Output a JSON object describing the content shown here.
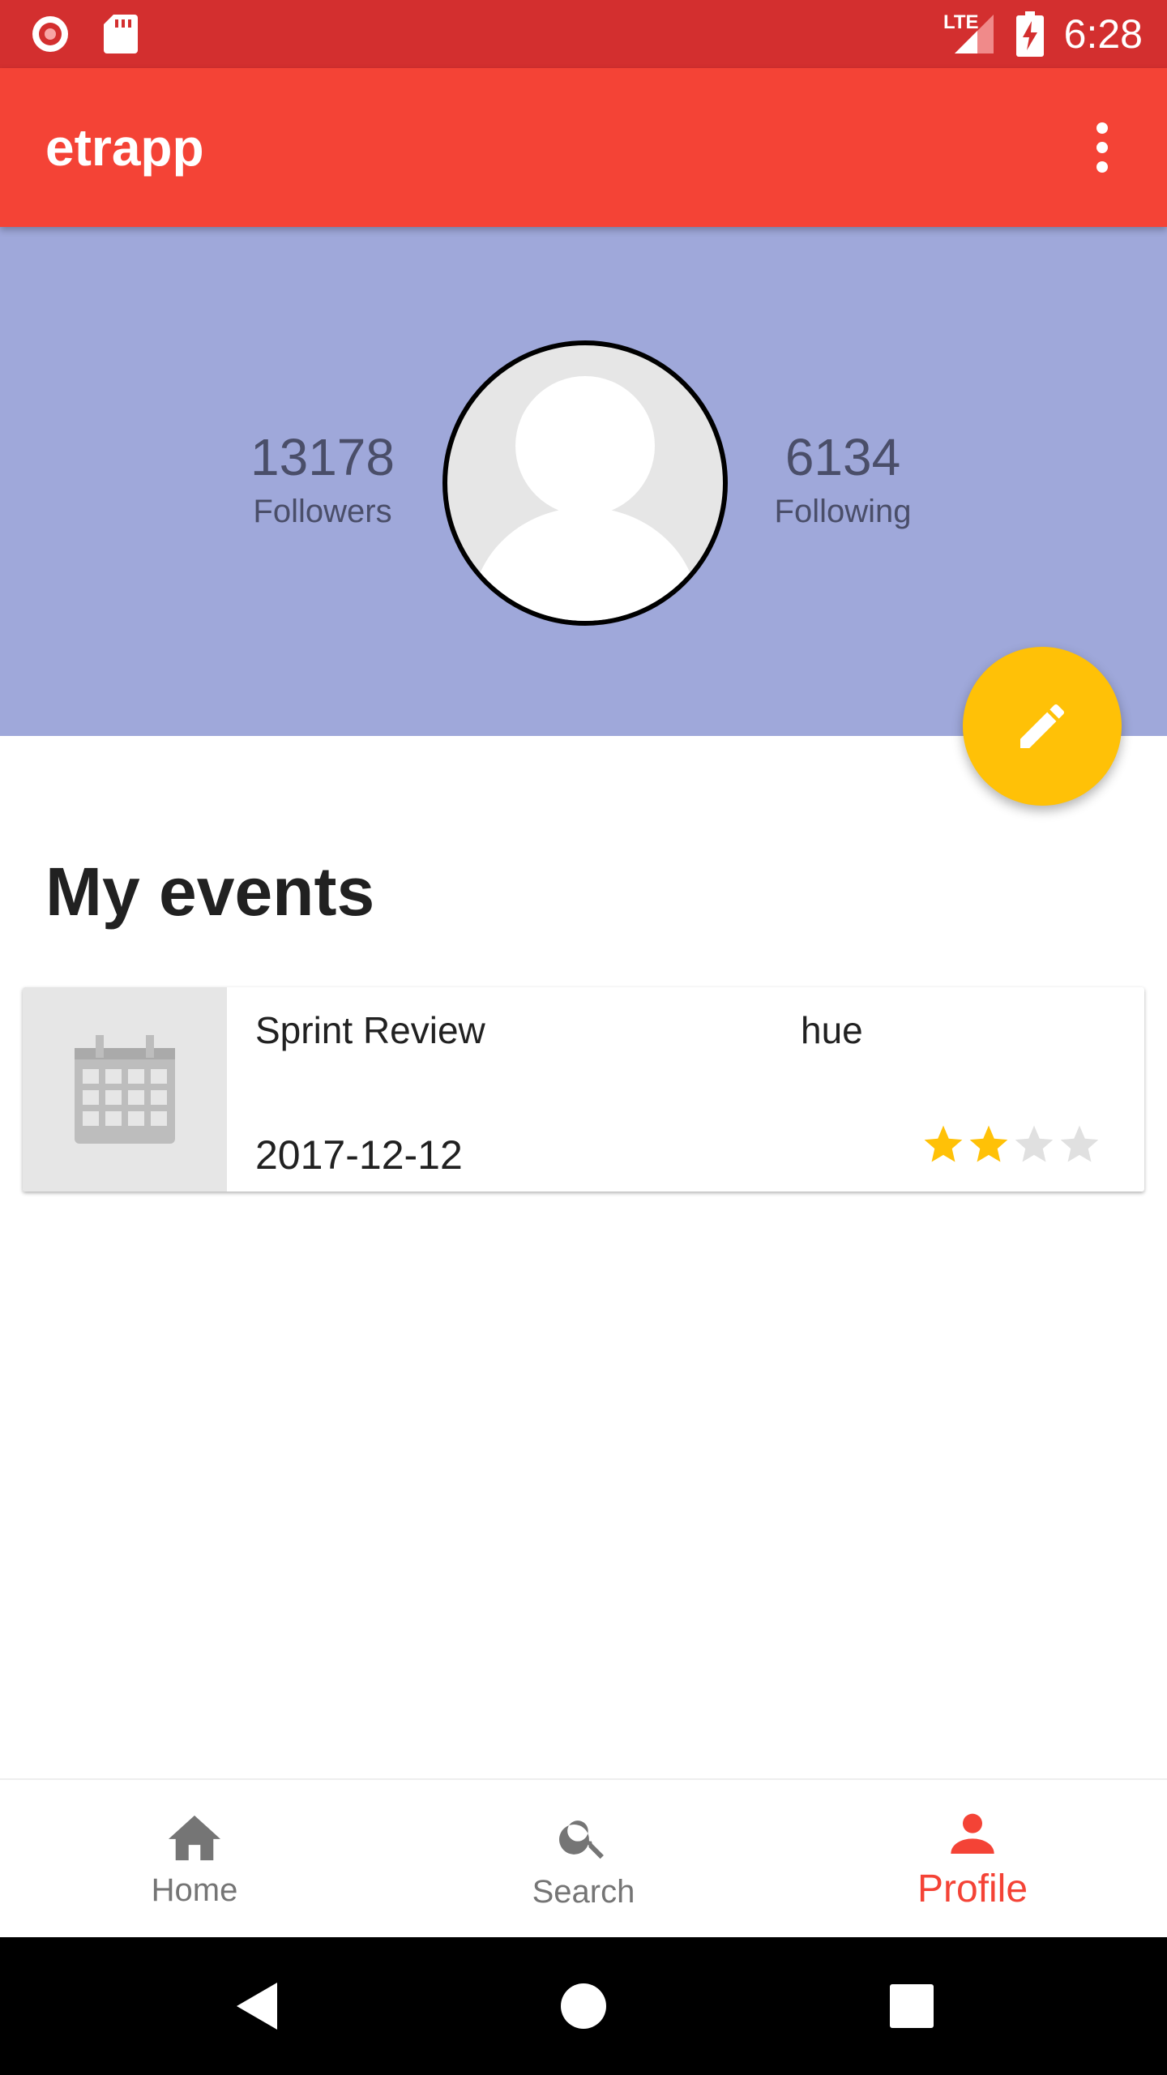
{
  "status_bar": {
    "time": "6:28",
    "network": "LTE",
    "icons": [
      "record-icon",
      "sd-card-icon",
      "signal-icon",
      "battery-charging-icon"
    ]
  },
  "toolbar": {
    "title": "etrapp",
    "overflow_icon": "more-vert-icon"
  },
  "profile": {
    "followers_count": "13178",
    "followers_label": "Followers",
    "following_count": "6134",
    "following_label": "Following",
    "edit_icon": "pencil-icon"
  },
  "events": {
    "title": "My events",
    "items": [
      {
        "name": "Sprint Review",
        "owner": "hue",
        "date": "2017-12-12",
        "rating": 2,
        "rating_max": 4
      }
    ]
  },
  "bottom_nav": {
    "items": [
      {
        "label": "Home",
        "icon": "home-icon",
        "active": false
      },
      {
        "label": "Search",
        "icon": "search-icon",
        "active": false
      },
      {
        "label": "Profile",
        "icon": "person-icon",
        "active": true
      }
    ]
  },
  "colors": {
    "status_bar": "#d32f2f",
    "toolbar": "#f44336",
    "header": "#9fa8da",
    "fab": "#ffc107",
    "star_on": "#ffc107",
    "star_off": "#e0e0e0",
    "active_nav": "#f44336"
  }
}
